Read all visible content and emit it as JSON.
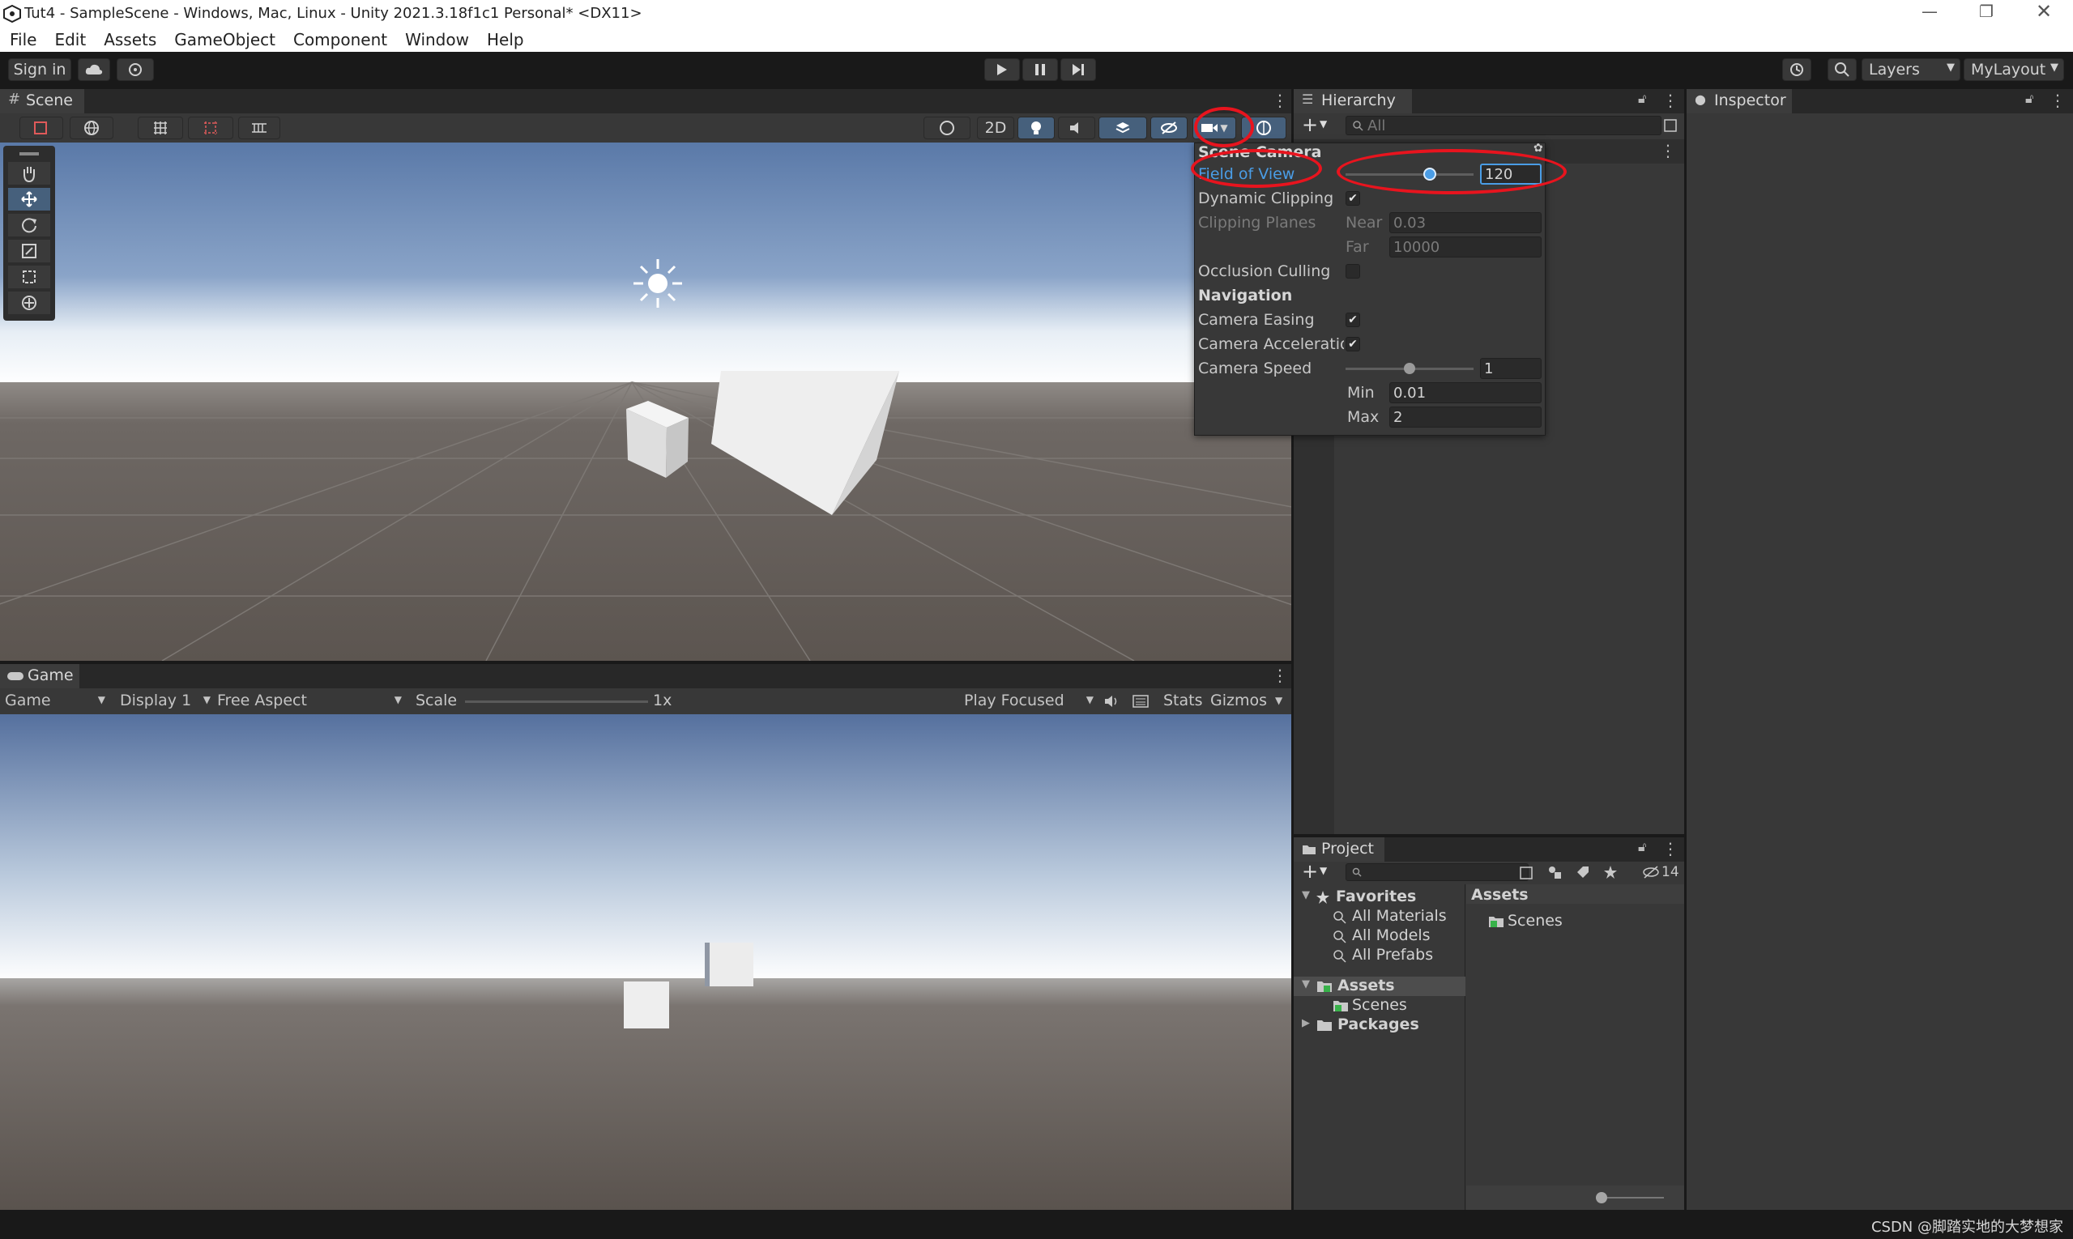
{
  "window": {
    "title": "Tut4 - SampleScene - Windows, Mac, Linux - Unity 2021.3.18f1c1 Personal* <DX11>"
  },
  "menu": [
    "File",
    "Edit",
    "Assets",
    "GameObject",
    "Component",
    "Window",
    "Help"
  ],
  "toolbar": {
    "sign_in": "Sign in",
    "layers": "Layers",
    "layout": "MyLayout"
  },
  "scene": {
    "tab": "Scene",
    "mode_2d": "2D"
  },
  "scene_camera": {
    "title": "Scene Camera",
    "fov_label": "Field of View",
    "fov_value": "120",
    "fov_fraction": 0.66,
    "dynamic_clipping_label": "Dynamic Clipping",
    "dynamic_clipping": true,
    "clipping_planes_label": "Clipping Planes",
    "near_label": "Near",
    "near_value": "0.03",
    "far_label": "Far",
    "far_value": "10000",
    "occlusion_label": "Occlusion Culling",
    "occlusion": false,
    "navigation_label": "Navigation",
    "easing_label": "Camera Easing",
    "easing": true,
    "acceleration_label": "Camera Acceleratior",
    "acceleration": true,
    "speed_label": "Camera Speed",
    "speed_value": "1",
    "speed_fraction": 0.5,
    "min_label": "Min",
    "min_value": "0.01",
    "max_label": "Max",
    "max_value": "2"
  },
  "game": {
    "tab": "Game",
    "view_select": "Game",
    "display_select": "Display 1",
    "aspect_select": "Free Aspect",
    "scale_label": "Scale",
    "scale_value": "1x",
    "play_mode": "Play Focused",
    "stats": "Stats",
    "gizmos": "Gizmos"
  },
  "hierarchy": {
    "tab": "Hierarchy",
    "search_placeholder": "All"
  },
  "inspector": {
    "tab": "Inspector"
  },
  "project": {
    "tab": "Project",
    "hidden_count": "14",
    "favorites": "Favorites",
    "favorite_items": [
      "All Materials",
      "All Models",
      "All Prefabs"
    ],
    "assets": "Assets",
    "scenes": "Scenes",
    "packages": "Packages",
    "content_header": "Assets",
    "content_item": "Scenes"
  },
  "watermark": "CSDN @脚踏实地的大梦想家",
  "colors": {
    "highlight_red": "#e8141e",
    "accent_blue": "#4a9de6",
    "panel_bg": "#383838"
  }
}
